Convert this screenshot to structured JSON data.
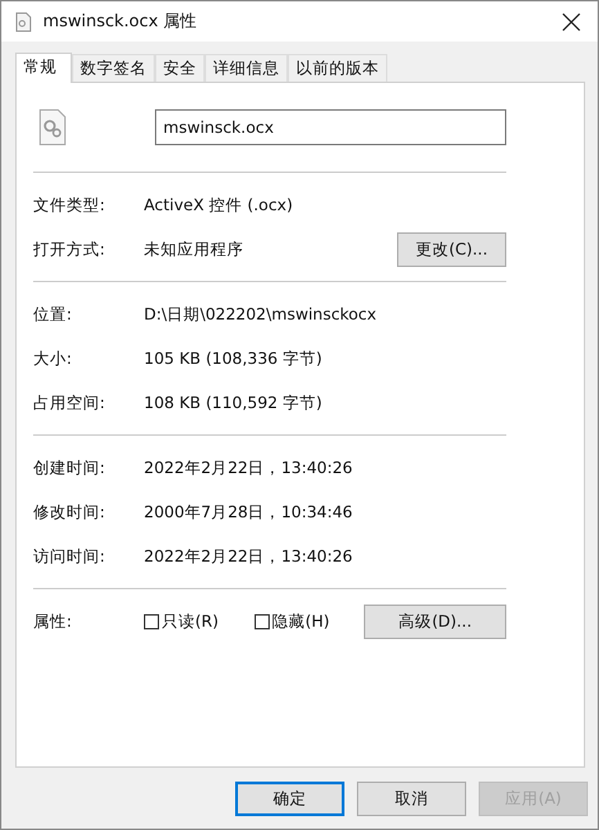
{
  "window": {
    "title": "mswinsck.ocx 属性"
  },
  "tabs": [
    {
      "label": "常规",
      "selected": true
    },
    {
      "label": "数字签名",
      "selected": false
    },
    {
      "label": "安全",
      "selected": false
    },
    {
      "label": "详细信息",
      "selected": false
    },
    {
      "label": "以前的版本",
      "selected": false
    }
  ],
  "file_name": "mswinsck.ocx",
  "sections": [
    [
      {
        "kind": "text",
        "label": "文件类型:",
        "value": "ActiveX 控件 (.ocx)"
      },
      {
        "kind": "text",
        "label": "打开方式:",
        "value": "未知应用程序",
        "button": "更改(C)..."
      }
    ],
    [
      {
        "kind": "text",
        "label": "位置:",
        "value": "D:\\日期\\022202\\mswinsckocx"
      },
      {
        "kind": "text",
        "label": "大小:",
        "value": "105 KB (108,336 字节)"
      },
      {
        "kind": "text",
        "label": "占用空间:",
        "value": "108 KB (110,592 字节)"
      }
    ],
    [
      {
        "kind": "text",
        "label": "创建时间:",
        "value": "2022年2月22日，13:40:26"
      },
      {
        "kind": "text",
        "label": "修改时间:",
        "value": "2000年7月28日，10:34:46"
      },
      {
        "kind": "text",
        "label": "访问时间:",
        "value": "2022年2月22日，13:40:26"
      }
    ],
    [
      {
        "kind": "attributes",
        "label": "属性:",
        "checkboxes": [
          {
            "label": "只读(R)",
            "checked": false
          },
          {
            "label": "隐藏(H)",
            "checked": false
          }
        ],
        "button": "高级(D)..."
      }
    ]
  ],
  "buttons": [
    {
      "label": "确定",
      "focused": true,
      "disabled": false
    },
    {
      "label": "取消",
      "focused": false,
      "disabled": false
    },
    {
      "label": "应用(A)",
      "focused": false,
      "disabled": true
    }
  ]
}
